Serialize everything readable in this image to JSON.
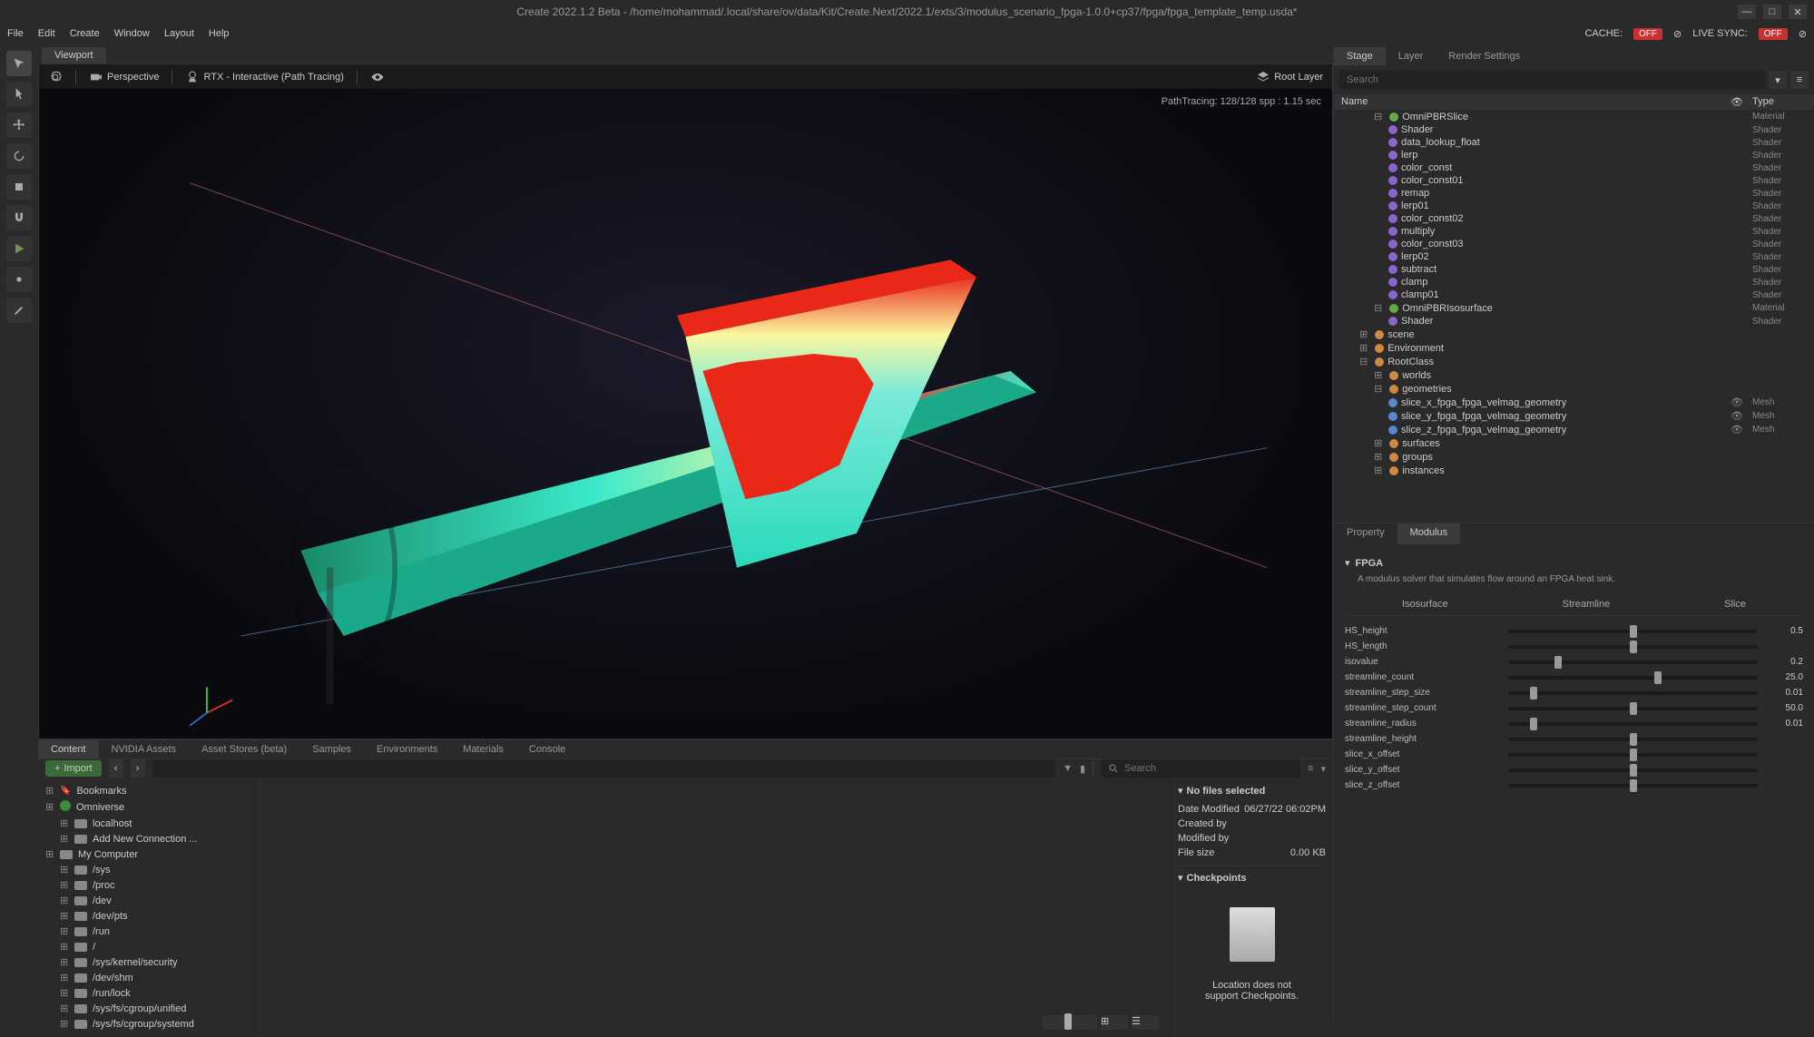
{
  "window": {
    "title": "Create 2022.1.2 Beta - /home/mohammad/.local/share/ov/data/Kit/Create.Next/2022.1/exts/3/modulus_scenario_fpga-1.0.0+cp37/fpga/fpga_template_temp.usda*"
  },
  "menu": {
    "items": [
      "File",
      "Edit",
      "Create",
      "Window",
      "Layout",
      "Help"
    ],
    "cache_label": "CACHE:",
    "cache_status": "OFF",
    "livesync_label": "LIVE SYNC:",
    "livesync_status": "OFF"
  },
  "viewport": {
    "tab": "Viewport",
    "perspective": "Perspective",
    "renderer": "RTX - Interactive (Path Tracing)",
    "root_layer": "Root Layer",
    "stats": "PathTracing: 128/128 spp : 1.15 sec"
  },
  "bottom_tabs": [
    "Content",
    "NVIDIA Assets",
    "Asset Stores (beta)",
    "Samples",
    "Environments",
    "Materials",
    "Console"
  ],
  "import_label": "Import",
  "search_placeholder": "Search",
  "file_tree": [
    {
      "label": "Bookmarks",
      "indent": 0,
      "icon": "bookmark"
    },
    {
      "label": "Omniverse",
      "indent": 0,
      "icon": "ov"
    },
    {
      "label": "localhost",
      "indent": 1,
      "icon": "disk"
    },
    {
      "label": "Add New Connection ...",
      "indent": 1,
      "icon": "plus"
    },
    {
      "label": "My Computer",
      "indent": 0,
      "icon": "computer"
    },
    {
      "label": "/sys",
      "indent": 1,
      "icon": "disk"
    },
    {
      "label": "/proc",
      "indent": 1,
      "icon": "disk"
    },
    {
      "label": "/dev",
      "indent": 1,
      "icon": "disk"
    },
    {
      "label": "/dev/pts",
      "indent": 1,
      "icon": "disk"
    },
    {
      "label": "/run",
      "indent": 1,
      "icon": "disk"
    },
    {
      "label": "/",
      "indent": 1,
      "icon": "disk"
    },
    {
      "label": "/sys/kernel/security",
      "indent": 1,
      "icon": "disk"
    },
    {
      "label": "/dev/shm",
      "indent": 1,
      "icon": "disk"
    },
    {
      "label": "/run/lock",
      "indent": 1,
      "icon": "disk"
    },
    {
      "label": "/sys/fs/cgroup/unified",
      "indent": 1,
      "icon": "disk"
    },
    {
      "label": "/sys/fs/cgroup/systemd",
      "indent": 1,
      "icon": "disk"
    }
  ],
  "file_info": {
    "header": "No files selected",
    "date_modified_label": "Date Modified",
    "date_modified": "06/27/22 06:02PM",
    "created_by_label": "Created by",
    "created_by": "",
    "modified_by_label": "Modified by",
    "modified_by": "",
    "file_size_label": "File size",
    "file_size": "0.00 KB",
    "checkpoints_label": "Checkpoints",
    "checkpoint_msg1": "Location does not",
    "checkpoint_msg2": "support Checkpoints."
  },
  "right_tabs": [
    "Stage",
    "Layer",
    "Render Settings"
  ],
  "stage_cols": {
    "name": "Name",
    "type": "Type"
  },
  "stage_tree": [
    {
      "label": "OmniPBRSlice",
      "type": "Material",
      "indent": 1,
      "icon": "ni-green",
      "exp": "⊟"
    },
    {
      "label": "Shader",
      "type": "Shader",
      "indent": 2,
      "icon": "ni-purple"
    },
    {
      "label": "data_lookup_float",
      "type": "Shader",
      "indent": 2,
      "icon": "ni-purple"
    },
    {
      "label": "lerp",
      "type": "Shader",
      "indent": 2,
      "icon": "ni-purple"
    },
    {
      "label": "color_const",
      "type": "Shader",
      "indent": 2,
      "icon": "ni-purple"
    },
    {
      "label": "color_const01",
      "type": "Shader",
      "indent": 2,
      "icon": "ni-purple"
    },
    {
      "label": "remap",
      "type": "Shader",
      "indent": 2,
      "icon": "ni-purple"
    },
    {
      "label": "lerp01",
      "type": "Shader",
      "indent": 2,
      "icon": "ni-purple"
    },
    {
      "label": "color_const02",
      "type": "Shader",
      "indent": 2,
      "icon": "ni-purple"
    },
    {
      "label": "multiply",
      "type": "Shader",
      "indent": 2,
      "icon": "ni-purple"
    },
    {
      "label": "color_const03",
      "type": "Shader",
      "indent": 2,
      "icon": "ni-purple"
    },
    {
      "label": "lerp02",
      "type": "Shader",
      "indent": 2,
      "icon": "ni-purple"
    },
    {
      "label": "subtract",
      "type": "Shader",
      "indent": 2,
      "icon": "ni-purple"
    },
    {
      "label": "clamp",
      "type": "Shader",
      "indent": 2,
      "icon": "ni-purple"
    },
    {
      "label": "clamp01",
      "type": "Shader",
      "indent": 2,
      "icon": "ni-purple"
    },
    {
      "label": "OmniPBRIsosurface",
      "type": "Material",
      "indent": 1,
      "icon": "ni-green",
      "exp": "⊟"
    },
    {
      "label": "Shader",
      "type": "Shader",
      "indent": 2,
      "icon": "ni-purple"
    },
    {
      "label": "scene",
      "type": "",
      "indent": 0,
      "icon": "ni-orange",
      "exp": "⊞"
    },
    {
      "label": "Environment",
      "type": "",
      "indent": 0,
      "icon": "ni-orange",
      "exp": "⊞"
    },
    {
      "label": "RootClass",
      "type": "",
      "indent": 0,
      "icon": "ni-orange",
      "exp": "⊟"
    },
    {
      "label": "worlds",
      "type": "",
      "indent": 1,
      "icon": "ni-orange",
      "exp": "⊞"
    },
    {
      "label": "geometries",
      "type": "",
      "indent": 1,
      "icon": "ni-orange",
      "exp": "⊟"
    },
    {
      "label": "slice_x_fpga_fpga_velmag_geometry",
      "type": "Mesh",
      "indent": 2,
      "icon": "ni-blue",
      "vis": "👁"
    },
    {
      "label": "slice_y_fpga_fpga_velmag_geometry",
      "type": "Mesh",
      "indent": 2,
      "icon": "ni-blue",
      "vis": "👁"
    },
    {
      "label": "slice_z_fpga_fpga_velmag_geometry",
      "type": "Mesh",
      "indent": 2,
      "icon": "ni-blue",
      "vis": "👁"
    },
    {
      "label": "surfaces",
      "type": "",
      "indent": 1,
      "icon": "ni-orange",
      "exp": "⊞"
    },
    {
      "label": "groups",
      "type": "",
      "indent": 1,
      "icon": "ni-orange",
      "exp": "⊞"
    },
    {
      "label": "instances",
      "type": "",
      "indent": 1,
      "icon": "ni-orange",
      "exp": "⊞"
    }
  ],
  "property_tabs": [
    "Property",
    "Modulus"
  ],
  "modulus": {
    "section": "FPGA",
    "description": "A modulus solver that simulates flow around an FPGA heat sink.",
    "modes": [
      "Isosurface",
      "Streamline",
      "Slice"
    ],
    "sliders": [
      {
        "label": "HS_height",
        "value": "0.5",
        "pos": 50
      },
      {
        "label": "HS_length",
        "value": "",
        "pos": 50
      },
      {
        "label": "isovalue",
        "value": "0.2",
        "pos": 20
      },
      {
        "label": "streamline_count",
        "value": "25.0",
        "pos": 60
      },
      {
        "label": "streamline_step_size",
        "value": "0.01",
        "pos": 10
      },
      {
        "label": "streamline_step_count",
        "value": "50.0",
        "pos": 50
      },
      {
        "label": "streamline_radius",
        "value": "0.01",
        "pos": 10
      },
      {
        "label": "streamline_height",
        "value": "",
        "pos": 50
      },
      {
        "label": "slice_x_offset",
        "value": "",
        "pos": 50
      },
      {
        "label": "slice_y_offset",
        "value": "",
        "pos": 50
      },
      {
        "label": "slice_z_offset",
        "value": "",
        "pos": 50
      }
    ]
  }
}
